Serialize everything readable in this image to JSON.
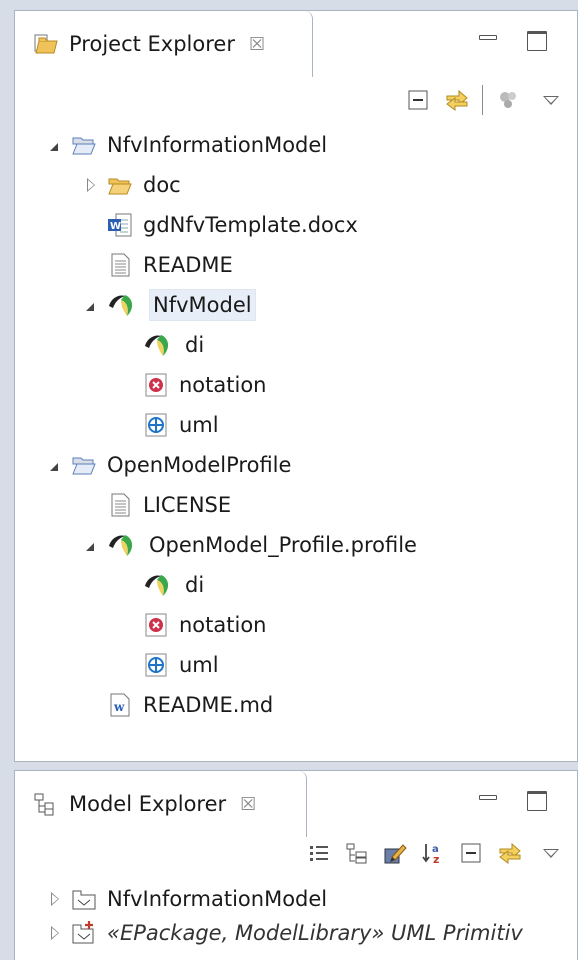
{
  "project_explorer": {
    "title": "Project Explorer",
    "close_glyph": "☒",
    "rows": [
      {
        "label": "NfvInformationModel",
        "icon": "folder-open-icon",
        "twisty": "expanded",
        "depth": 0
      },
      {
        "label": "doc",
        "icon": "folder-icon",
        "twisty": "collapsed",
        "depth": 1
      },
      {
        "label": "gdNfvTemplate.docx",
        "icon": "word-document-icon",
        "twisty": "none",
        "depth": 1
      },
      {
        "label": "README",
        "icon": "text-file-icon",
        "twisty": "none",
        "depth": 1
      },
      {
        "label": "NfvModel",
        "icon": "papyrus-model-icon",
        "twisty": "expanded",
        "depth": 1,
        "selected": true
      },
      {
        "label": "di",
        "icon": "papyrus-di-icon",
        "twisty": "none",
        "depth": 2
      },
      {
        "label": "notation",
        "icon": "notation-icon",
        "twisty": "none",
        "depth": 2
      },
      {
        "label": "uml",
        "icon": "uml-icon",
        "twisty": "none",
        "depth": 2
      },
      {
        "label": "OpenModelProfile",
        "icon": "folder-open-icon",
        "twisty": "expanded",
        "depth": 0
      },
      {
        "label": "LICENSE",
        "icon": "text-file-icon",
        "twisty": "none",
        "depth": 1
      },
      {
        "label": "OpenModel_Profile.profile",
        "icon": "papyrus-model-icon",
        "twisty": "expanded",
        "depth": 1
      },
      {
        "label": "di",
        "icon": "papyrus-di-icon",
        "twisty": "none",
        "depth": 2
      },
      {
        "label": "notation",
        "icon": "notation-icon",
        "twisty": "none",
        "depth": 2
      },
      {
        "label": "uml",
        "icon": "uml-icon",
        "twisty": "none",
        "depth": 2
      },
      {
        "label": "README.md",
        "icon": "markdown-word-icon",
        "twisty": "none",
        "depth": 1
      }
    ]
  },
  "model_explorer": {
    "title": "Model Explorer",
    "close_glyph": "☒",
    "rows": [
      {
        "label": "NfvInformationModel",
        "icon": "model-package-icon",
        "twisty": "collapsed",
        "depth": 0,
        "italic": false
      },
      {
        "label": "«EPackage, ModelLibrary» UML Primitiv",
        "icon": "model-library-icon",
        "twisty": "collapsed",
        "depth": 0,
        "italic": true
      }
    ]
  },
  "colors": {
    "accent": "#3b78c2",
    "folder": "#e9b94a",
    "papyrus_green": "#3aa84a",
    "selection": "#e7eef8"
  }
}
